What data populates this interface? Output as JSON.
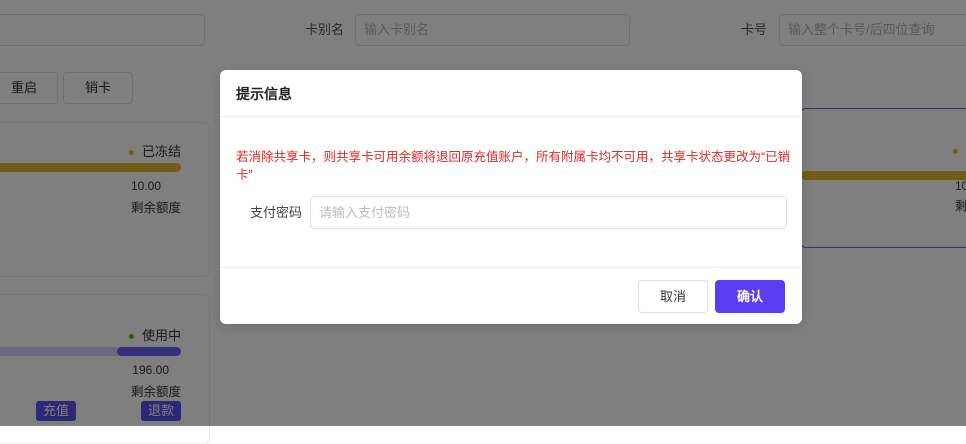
{
  "filters": {
    "alias_label": "卡别名",
    "alias_placeholder": "输入卡别名",
    "card_no_label": "卡号",
    "card_no_placeholder": "输入整个卡号/后四位查询"
  },
  "toolbar": {
    "reset_label": "重启",
    "cancel_card_label": "销卡"
  },
  "cards": [
    {
      "status": "已冻结",
      "status_color": "#f5b400",
      "bar_color": "#e9b733",
      "amount": "10.00",
      "amount_label": "剩余额度"
    },
    {
      "status": "使用中",
      "status_color": "#52c41a",
      "bar_color": "#6a5cf0",
      "amount": "196.00",
      "amount_label": "剩余额度",
      "recharge_label": "充值",
      "refund_label": "退款"
    }
  ],
  "right_card": {
    "amount_partial": "10",
    "amount_label_partial": "剩"
  },
  "modal": {
    "title": "提示信息",
    "warning": "若消除共享卡，则共享卡可用余额将退回原充值账户，所有附属卡均不可用，共享卡状态更改为“已销卡”",
    "password_label": "支付密码",
    "password_placeholder": "请输入支付密码",
    "cancel_label": "取消",
    "confirm_label": "确认"
  },
  "colors": {
    "accent": "#5a3df2",
    "warning_text": "#e0281f",
    "frozen": "#f5b400",
    "active": "#52c41a"
  }
}
